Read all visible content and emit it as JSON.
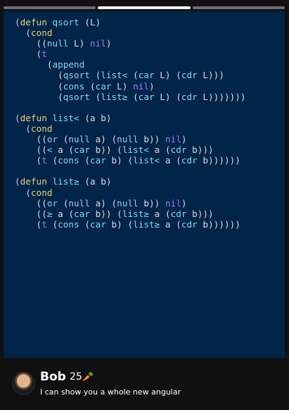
{
  "story_progress": {
    "segments": 3,
    "active_segment": 2
  },
  "code": {
    "lines": [
      "(defun qsort (L)",
      "  (cond",
      "    ((null L) nil)",
      "    (t",
      "      (append",
      "        (qsort (list< (car L) (cdr L)))",
      "        (cons (car L) nil)",
      "        (qsort (list≥ (car L) (cdr L)))))))",
      "",
      "(defun list< (a b)",
      "  (cond",
      "    ((or (null a) (null b)) nil)",
      "    ((< a (car b)) (list< a (cdr b)))",
      "    (t (cons (car b) (list< a (cdr b))))))",
      "",
      "(defun list≥ (a b)",
      "  (cond",
      "    ((or (null a) (null b)) nil)",
      "    ((≥ a (car b)) (list≥ a (cdr b)))",
      "    (t (cons (car b) (list≥ a (cdr b))))))"
    ]
  },
  "comment": {
    "username": "Bob",
    "score": "25",
    "badge_icon": "carrot-icon",
    "text": "I can show you a whole new angular"
  },
  "colors": {
    "editor_background": "#012449",
    "keyword": "#e4d57a",
    "nil": "#9b7ce8",
    "call": "#8ad7ef"
  }
}
